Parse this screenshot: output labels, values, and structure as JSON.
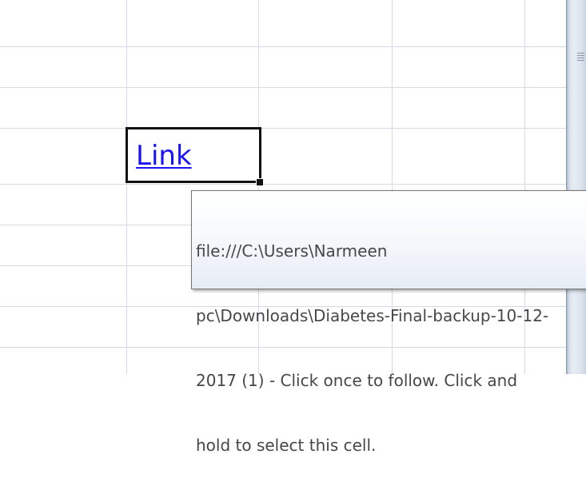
{
  "cell": {
    "link_text": "Link"
  },
  "tooltip": {
    "line1": "file:///C:\\Users\\Narmeen",
    "line2": "pc\\Downloads\\Diabetes-Final-backup-10-12-",
    "line3": "2017 (1) - Click once to follow. Click and",
    "line4": "hold to select this cell."
  },
  "icons": {
    "scroll_grip": "grip-lines-icon"
  },
  "colors": {
    "gridline": "#d5dbe6",
    "link": "#1a14f2",
    "selection_border": "#111111",
    "tooltip_text": "#474747"
  }
}
